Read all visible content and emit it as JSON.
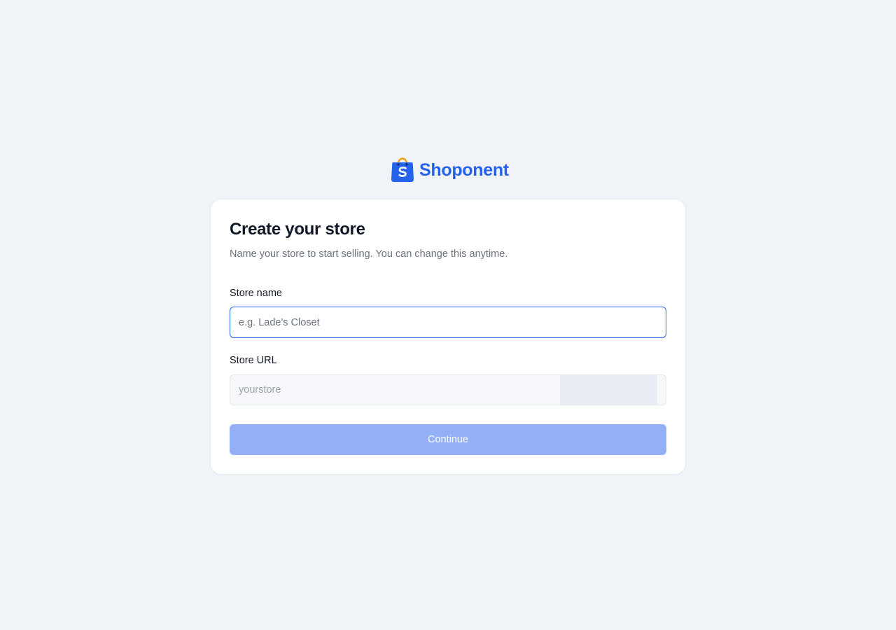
{
  "brand": {
    "name": "Shoponent",
    "logo_icon": "shopping-bag-icon",
    "color": "#2563eb",
    "handle_color": "#f59e0b"
  },
  "form": {
    "title": "Create your store",
    "subtitle": "Name your store to start selling. You can change this anytime.",
    "store_name": {
      "label": "Store name",
      "value": "",
      "placeholder": "e.g. Lade's Closet"
    },
    "store_url": {
      "label": "Store URL",
      "value": "",
      "placeholder": "yourstore",
      "suffix": ""
    },
    "continue_label": "Continue",
    "continue_disabled": true
  },
  "colors": {
    "background": "#f0f4f9",
    "accent": "#2563eb",
    "button_disabled": "#93b0f7"
  }
}
